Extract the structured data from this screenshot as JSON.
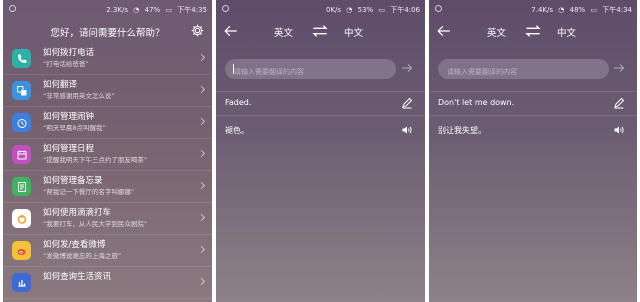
{
  "colors": {
    "phone_icon": "#2bb3a8",
    "translate_icon": "#3a93e0",
    "alarm_icon": "#3c7fe0",
    "calendar_icon": "#c04fbf",
    "memo_icon": "#3fb35e",
    "didi_icon": "#f0a021",
    "weibo_icon": "#e9483c",
    "life_icon": "#3a6bd6"
  },
  "panel1": {
    "status": {
      "speed": "2.3K/s",
      "battery": "47%",
      "time": "下午4:35"
    },
    "title": "您好，请问需要什么帮助？",
    "items": [
      {
        "title": "如何拨打电话",
        "sub": "“打电话给爸爸”",
        "icon": "phone-icon"
      },
      {
        "title": "如何翻译",
        "sub": "“非常感谢用英文怎么说”",
        "icon": "translate-icon"
      },
      {
        "title": "如何管理闹钟",
        "sub": "“明天早晨8点叫醒我”",
        "icon": "alarm-icon"
      },
      {
        "title": "如何管理日程",
        "sub": "“提醒我明天下午三点约了朋友喝茶”",
        "icon": "calendar-icon"
      },
      {
        "title": "如何管理备忘录",
        "sub": "“帮我记一下餐厅的名字叫娜娜”",
        "icon": "memo-icon"
      },
      {
        "title": "如何使用滴滴打车",
        "sub": "“我要打车，从人民大学到民众剧院”",
        "icon": "car-icon"
      },
      {
        "title": "如何发/查看微博",
        "sub": "“发微博说难忘的上海之旅”",
        "icon": "weibo-icon"
      },
      {
        "title": "如何查询生活资讯",
        "sub": "",
        "icon": "life-icon"
      }
    ]
  },
  "panel2": {
    "status": {
      "speed": "0K/s",
      "battery": "53%",
      "time": "下午4:06"
    },
    "source_lang": "英文",
    "target_lang": "中文",
    "input_placeholder": "请输入需要翻译的内容",
    "source_text": "Faded.",
    "translated_text": "褪色。"
  },
  "panel3": {
    "status": {
      "speed": "7.4K/s",
      "battery": "48%",
      "time": "下午4:34"
    },
    "source_lang": "英文",
    "target_lang": "中文",
    "input_placeholder": "请输入需要翻译的内容",
    "source_text": "Don't let me down.",
    "translated_text": "别让我失望。"
  }
}
